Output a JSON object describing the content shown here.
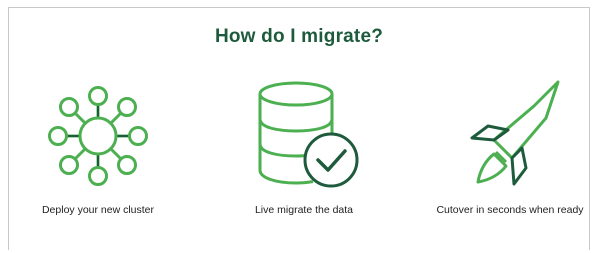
{
  "header": {
    "title": "How do I migrate?"
  },
  "steps": [
    {
      "label": "Deploy your new cluster",
      "icon": "cluster-icon"
    },
    {
      "label": "Live migrate the data",
      "icon": "database-check-icon"
    },
    {
      "label": "Cutover in seconds when ready",
      "icon": "rocket-icon"
    }
  ],
  "colors": {
    "title": "#1e5b3c",
    "icon_light": "#4caf50",
    "icon_dark": "#1e5b3c"
  }
}
